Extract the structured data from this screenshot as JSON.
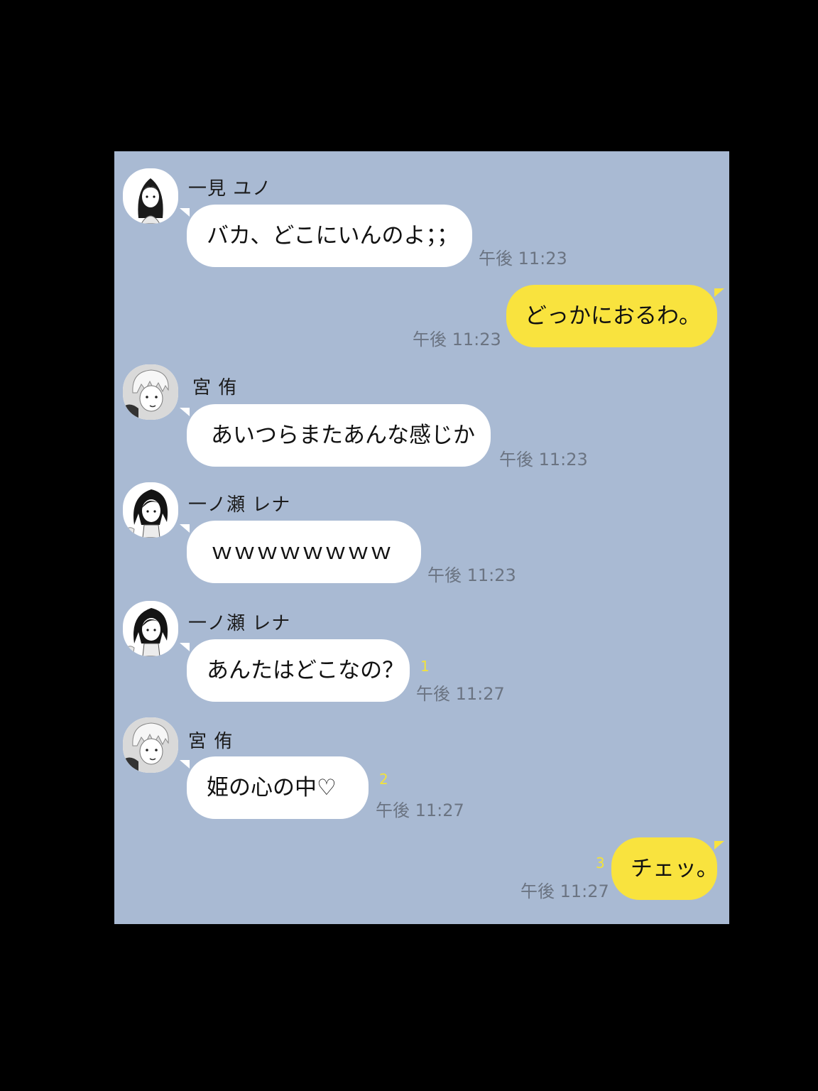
{
  "messages": [
    {
      "sender": "一見 ユノ",
      "avatar": "girl-long-hair-avatar",
      "text": "バカ、どこにいんのよ；；",
      "time": "午後 11:23"
    },
    {
      "text": "どっかにおるわ。",
      "time": "午後 11:23"
    },
    {
      "sender": "宮 侑",
      "avatar": "blond-boy-avatar",
      "text": "あいつらまたあんな感じか",
      "time": "午後 11:23"
    },
    {
      "sender": "一ノ瀬 レナ",
      "avatar": "dark-hair-girl-avatar",
      "text": "ｗｗｗｗｗｗｗｗ",
      "time": "午後 11:23"
    },
    {
      "sender": "一ノ瀬 レナ",
      "avatar": "dark-hair-girl-avatar",
      "text": "あんたはどこなの？",
      "time": "午後 11:27",
      "read": "1"
    },
    {
      "sender": "宮 侑",
      "avatar": "blond-boy-avatar",
      "text": "姫の心の中♡",
      "time": "午後 11:27",
      "read": "2"
    },
    {
      "text": "チェッ。",
      "time": "午後 11:27",
      "read": "3"
    }
  ],
  "colors": {
    "background": "#a9bad3",
    "incoming_bubble": "#ffffff",
    "outgoing_bubble": "#f9e33e",
    "read_marker": "#f2e23b",
    "time": "#6b7482"
  }
}
